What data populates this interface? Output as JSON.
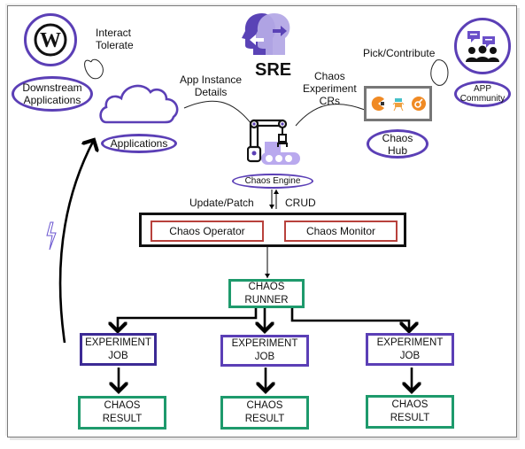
{
  "diagram": {
    "title": "SRE",
    "colors": {
      "purple_accent": "#5b3fb6",
      "green_box": "#1e9a6c",
      "red_box": "#b8413c",
      "orange_icon": "#f08a24"
    },
    "top_left": {
      "wordpress_icon": "wordpress-icon",
      "interact_label": "Interact\nTolerate",
      "interact_line1": "Interact",
      "interact_line2": "Tolerate",
      "downstream_line1": "Downstream",
      "downstream_line2": "Applications",
      "applications_label": "Applications"
    },
    "center_top": {
      "sre_icon": "sre-heads-icon",
      "sre_label": "SRE",
      "app_instance_line1": "App Instance",
      "app_instance_line2": "Details",
      "chaos_cr_line1": "Chaos",
      "chaos_cr_line2": "Experiment",
      "chaos_cr_line3": "CRs",
      "engine_icon": "robot-arm-icon",
      "chaos_engine_label": "Chaos Engine"
    },
    "top_right": {
      "pick_contribute": "Pick/Contribute",
      "community_icon": "community-chat-icon",
      "app_community_line1": "APP",
      "app_community_line2": "Community",
      "hub_icons": [
        "pacman-icon",
        "robot-icon",
        "chaos-logo-icon"
      ],
      "chaos_hub_line1": "Chaos",
      "chaos_hub_line2": "Hub"
    },
    "middle": {
      "update_patch": "Update/Patch",
      "crud": "CRUD",
      "chaos_operator": "Chaos Operator",
      "chaos_monitor": "Chaos Monitor",
      "chaos_runner_line1": "CHAOS",
      "chaos_runner_line2": "RUNNER"
    },
    "experiments": [
      {
        "job_line1": "EXPERIMENT",
        "job_line2": "JOB",
        "result_line1": "CHAOS",
        "result_line2": "RESULT"
      },
      {
        "job_line1": "EXPERIMENT",
        "job_line2": "JOB",
        "result_line1": "CHAOS",
        "result_line2": "RESULT"
      },
      {
        "job_line1": "EXPERIMENT",
        "job_line2": "JOB",
        "result_line1": "CHAOS",
        "result_line2": "RESULT"
      }
    ],
    "lightning_icon": "lightning-icon"
  }
}
